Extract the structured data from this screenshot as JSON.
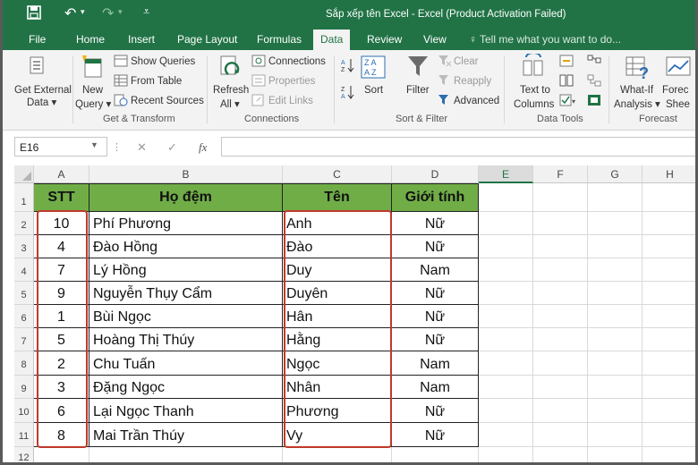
{
  "title": "Sắp xếp tên Excel - Excel (Product Activation Failed)",
  "tabs": [
    {
      "label": "File"
    },
    {
      "label": "Home"
    },
    {
      "label": "Insert"
    },
    {
      "label": "Page Layout"
    },
    {
      "label": "Formulas"
    },
    {
      "label": "Data"
    },
    {
      "label": "Review"
    },
    {
      "label": "View"
    }
  ],
  "tell_me": "Tell me what you want to do...",
  "ribbon": {
    "get_external_data": [
      "Get External",
      "Data ▾"
    ],
    "new_query": [
      "New",
      "Query ▾"
    ],
    "show_queries": "Show Queries",
    "from_table": "From Table",
    "recent_sources": "Recent Sources",
    "refresh_all": [
      "Refresh",
      "All ▾"
    ],
    "connections": "Connections",
    "properties": "Properties",
    "edit_links": "Edit Links",
    "sort": "Sort",
    "filter": "Filter",
    "clear": "Clear",
    "reapply": "Reapply",
    "advanced": "Advanced",
    "text_to_columns": [
      "Text to",
      "Columns"
    ],
    "what_if": [
      "What-If",
      "Analysis ▾"
    ],
    "forecast_sheet": [
      "Forec",
      "Shee"
    ],
    "groups": {
      "get_transform": "Get & Transform",
      "connections": "Connections",
      "sort_filter": "Sort & Filter",
      "data_tools": "Data Tools",
      "forecast": "Forecast"
    }
  },
  "name_box": "E16",
  "formula_icons": {
    "cancel": "✕",
    "enter": "✓",
    "fx": "fx"
  },
  "columns": [
    "A",
    "B",
    "C",
    "D",
    "E",
    "F",
    "G",
    "H"
  ],
  "header_row": [
    "STT",
    "Họ đệm",
    "Tên",
    "Giới tính"
  ],
  "rows": [
    {
      "stt": "10",
      "ho_dem": "Phí Phương",
      "ten": "Anh",
      "gioi_tinh": "Nữ"
    },
    {
      "stt": "4",
      "ho_dem": "Đào Hồng",
      "ten": "Đào",
      "gioi_tinh": "Nữ"
    },
    {
      "stt": "7",
      "ho_dem": "Lý Hồng",
      "ten": "Duy",
      "gioi_tinh": "Nam"
    },
    {
      "stt": "9",
      "ho_dem": "Nguyễn Thụy Cẩm",
      "ten": "Duyên",
      "gioi_tinh": "Nữ"
    },
    {
      "stt": "1",
      "ho_dem": "Bùi Ngọc",
      "ten": "Hân",
      "gioi_tinh": "Nữ"
    },
    {
      "stt": "5",
      "ho_dem": "Hoàng Thị Thúy",
      "ten": "Hằng",
      "gioi_tinh": "Nữ"
    },
    {
      "stt": "2",
      "ho_dem": "Chu Tuấn",
      "ten": "Ngọc",
      "gioi_tinh": "Nam"
    },
    {
      "stt": "3",
      "ho_dem": "Đặng Ngọc",
      "ten": "Nhân",
      "gioi_tinh": "Nam"
    },
    {
      "stt": "6",
      "ho_dem": "Lại Ngọc Thanh",
      "ten": "Phương",
      "gioi_tinh": "Nữ"
    },
    {
      "stt": "8",
      "ho_dem": "Mai Trần Thúy",
      "ten": "Vy",
      "gioi_tinh": "Nữ"
    }
  ],
  "row_numbers": [
    "1",
    "2",
    "3",
    "4",
    "5",
    "6",
    "7",
    "8",
    "9",
    "10",
    "11",
    "12"
  ],
  "colors": {
    "excel_green": "#217346",
    "header_fill": "#70ad47",
    "highlight_red": "#c0392b"
  }
}
